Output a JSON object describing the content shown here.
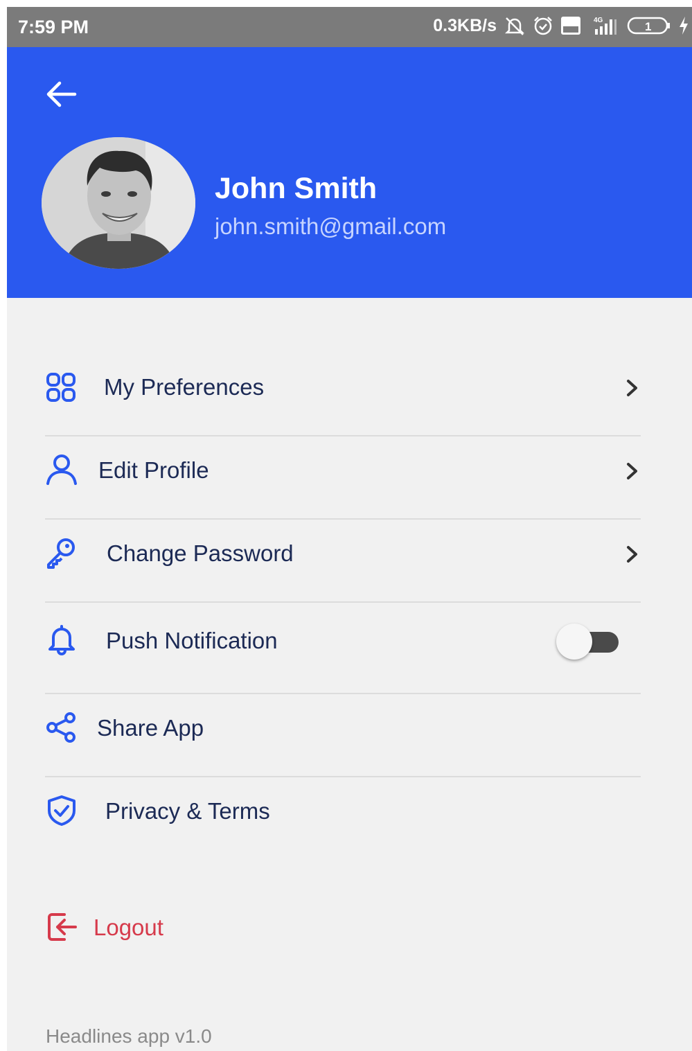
{
  "status_bar": {
    "time": "7:59 PM",
    "speed": "0.3KB/s",
    "signal_label": "4G",
    "battery_level": "1",
    "icons": [
      "mute-icon",
      "alarm-icon",
      "volte-icon",
      "signal-icon",
      "battery-icon",
      "charging-icon"
    ]
  },
  "header": {
    "background_color": "#2a59ef",
    "back_icon": "arrow-left-icon",
    "user": {
      "name": "John Smith",
      "email": "john.smith@gmail.com"
    }
  },
  "menu": {
    "accent_color": "#2a59ef",
    "items": [
      {
        "label": "My Preferences",
        "icon": "grid-icon",
        "trailing": "chevron"
      },
      {
        "label": "Edit Profile",
        "icon": "user-icon",
        "trailing": "chevron"
      },
      {
        "label": "Change Password",
        "icon": "key-icon",
        "trailing": "chevron"
      },
      {
        "label": "Push Notification",
        "icon": "bell-icon",
        "trailing": "toggle",
        "toggle_on": false
      },
      {
        "label": "Share App",
        "icon": "share-icon",
        "trailing": "none"
      },
      {
        "label": "Privacy & Terms",
        "icon": "shield-icon",
        "trailing": "none"
      }
    ]
  },
  "logout": {
    "label": "Logout",
    "icon": "logout-icon",
    "color": "#d63a4b"
  },
  "footer": {
    "version": "Headlines app v1.0"
  }
}
